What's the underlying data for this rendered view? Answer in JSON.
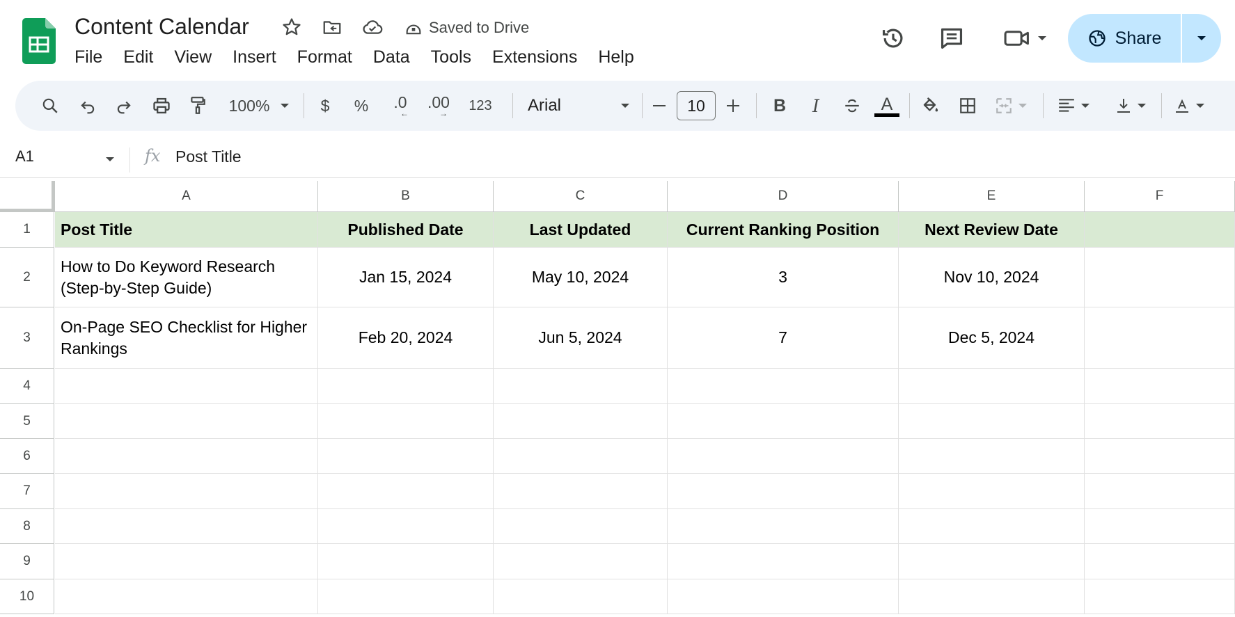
{
  "doc": {
    "title": "Content Calendar",
    "save_status": "Saved to Drive"
  },
  "menu": [
    "File",
    "Edit",
    "View",
    "Insert",
    "Format",
    "Data",
    "Tools",
    "Extensions",
    "Help"
  ],
  "share": {
    "label": "Share"
  },
  "toolbar": {
    "zoom": "100%",
    "currency": "$",
    "percent": "%",
    "decrease_decimal": ".0",
    "increase_decimal": ".00",
    "more_formats": "123",
    "font": "Arial",
    "font_size": "10",
    "text_color": "#000000"
  },
  "formula_bar": {
    "cell_ref": "A1",
    "fx": "fx",
    "content": "Post Title"
  },
  "sheet": {
    "columns": [
      "A",
      "B",
      "C",
      "D",
      "E",
      "F"
    ],
    "row_numbers": [
      "1",
      "2",
      "3",
      "4",
      "5",
      "6",
      "7",
      "8",
      "9",
      "10"
    ],
    "header_fill": "#d9ead3",
    "rows": [
      [
        "Post Title",
        "Published Date",
        "Last Updated",
        "Current Ranking Position",
        "Next Review Date",
        ""
      ],
      [
        "How to Do Keyword Research (Step-by-Step Guide)",
        "Jan 15, 2024",
        "May 10, 2024",
        "3",
        "Nov 10, 2024",
        ""
      ],
      [
        "On-Page SEO Checklist for Higher Rankings",
        "Feb 20, 2024",
        "Jun 5, 2024",
        "7",
        "Dec 5, 2024",
        ""
      ],
      [
        "",
        "",
        "",
        "",
        "",
        ""
      ],
      [
        "",
        "",
        "",
        "",
        "",
        ""
      ],
      [
        "",
        "",
        "",
        "",
        "",
        ""
      ],
      [
        "",
        "",
        "",
        "",
        "",
        ""
      ],
      [
        "",
        "",
        "",
        "",
        "",
        ""
      ],
      [
        "",
        "",
        "",
        "",
        "",
        ""
      ],
      [
        "",
        "",
        "",
        "",
        "",
        ""
      ]
    ]
  }
}
